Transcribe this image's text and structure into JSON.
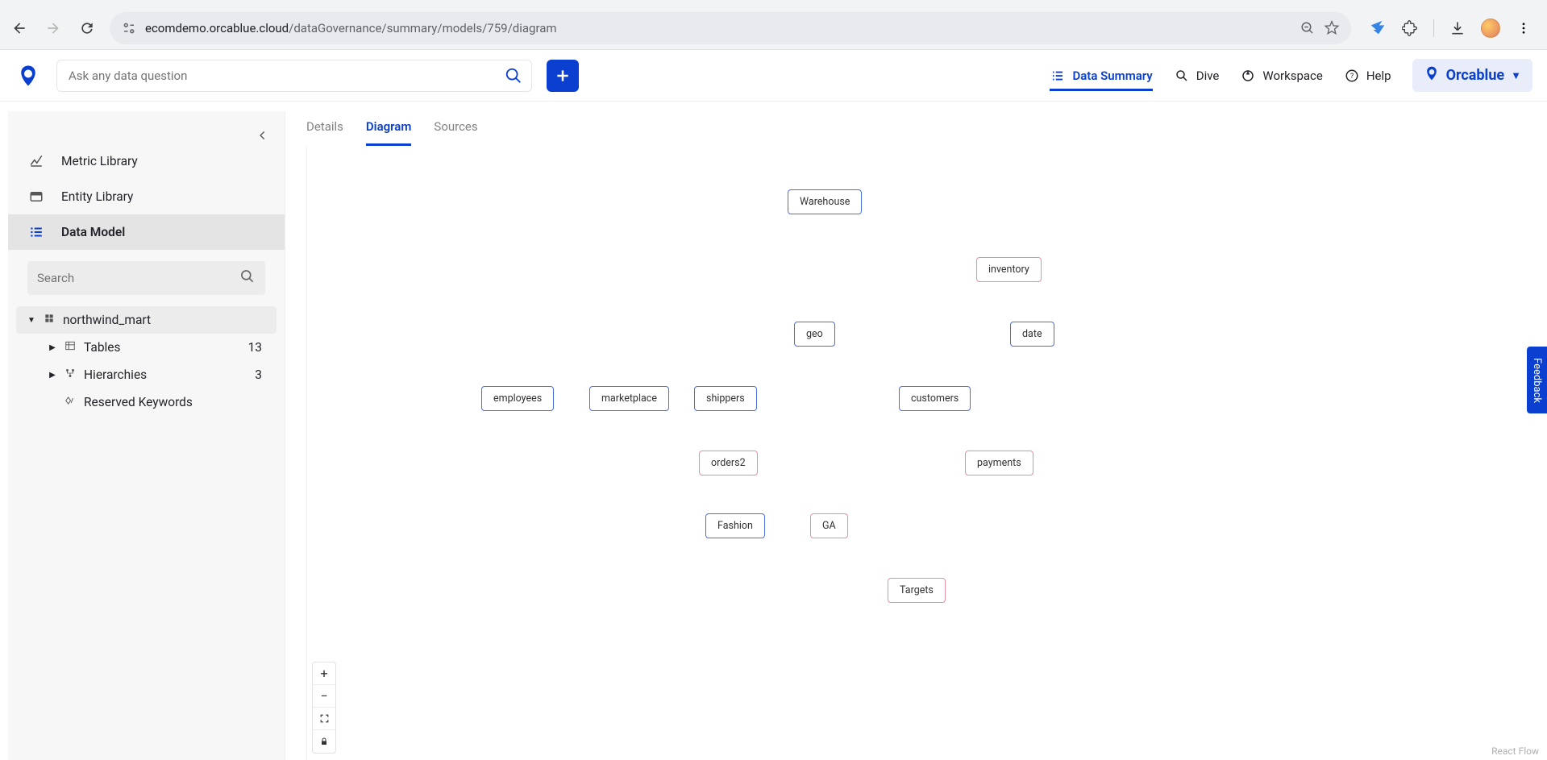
{
  "browser": {
    "url_host": "ecomdemo.orcablue.cloud",
    "url_path": "/dataGovernance/summary/models/759/diagram"
  },
  "header": {
    "search_placeholder": "Ask any data question",
    "nav": {
      "data_summary": "Data Summary",
      "dive": "Dive",
      "workspace": "Workspace",
      "help": "Help"
    },
    "brand": "Orcablue"
  },
  "sidebar": {
    "items": {
      "metric_library": "Metric Library",
      "entity_library": "Entity Library",
      "data_model": "Data Model"
    },
    "search_placeholder": "Search",
    "tree": {
      "root": "northwind_mart",
      "tables_label": "Tables",
      "tables_count": "13",
      "hierarchies_label": "Hierarchies",
      "hierarchies_count": "3",
      "reserved_label": "Reserved Keywords"
    }
  },
  "tabs": {
    "details": "Details",
    "diagram": "Diagram",
    "sources": "Sources"
  },
  "diagram": {
    "nodes": {
      "warehouse": "Warehouse",
      "inventory": "inventory",
      "geo": "geo",
      "date": "date",
      "employees": "employees",
      "marketplace": "marketplace",
      "shippers": "shippers",
      "customers": "customers",
      "orders2": "orders2",
      "payments": "payments",
      "fashion": "Fashion",
      "ga": "GA",
      "targets": "Targets"
    },
    "attribution": "React Flow"
  },
  "feedback": "Feedback"
}
